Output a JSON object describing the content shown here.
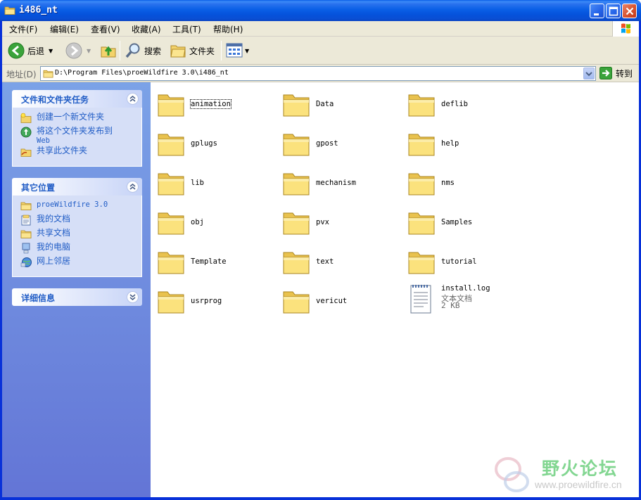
{
  "window": {
    "title": "i486_nt"
  },
  "menu": [
    "文件(F)",
    "编辑(E)",
    "查看(V)",
    "收藏(A)",
    "工具(T)",
    "帮助(H)"
  ],
  "toolbar": {
    "back": "后退",
    "search": "搜索",
    "folders": "文件夹"
  },
  "address": {
    "label": "地址(D)",
    "path": "D:\\Program Files\\proeWildfire 3.0\\i486_nt",
    "go": "转到"
  },
  "panels": {
    "tasks": {
      "title": "文件和文件夹任务",
      "items": [
        "创建一个新文件夹",
        "将这个文件夹发布到",
        "Web",
        "共享此文件夹"
      ]
    },
    "places": {
      "title": "其它位置",
      "items": [
        "proeWildfire 3.0",
        "我的文档",
        "共享文档",
        "我的电脑",
        "网上邻居"
      ]
    },
    "details": {
      "title": "详细信息"
    }
  },
  "files": [
    {
      "name": "animation"
    },
    {
      "name": "Data"
    },
    {
      "name": "deflib"
    },
    {
      "name": "gplugs"
    },
    {
      "name": "gpost"
    },
    {
      "name": "help"
    },
    {
      "name": "lib"
    },
    {
      "name": "mechanism"
    },
    {
      "name": "nms"
    },
    {
      "name": "obj"
    },
    {
      "name": "pvx"
    },
    {
      "name": "Samples"
    },
    {
      "name": "Template"
    },
    {
      "name": "text"
    },
    {
      "name": "tutorial"
    },
    {
      "name": "usrprog"
    },
    {
      "name": "vericut"
    }
  ],
  "logfile": {
    "name": "install.log",
    "type": "文本文档",
    "size": "2 KB"
  },
  "watermark": {
    "text": "野火论坛",
    "url": "www.proewildfire.cn"
  }
}
